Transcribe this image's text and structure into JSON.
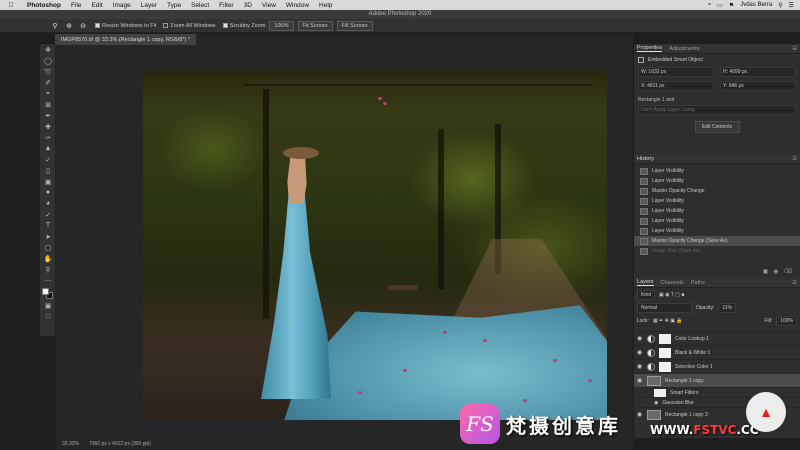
{
  "menubar": {
    "app": "Photoshop",
    "items": [
      "File",
      "Edit",
      "Image",
      "Layer",
      "Type",
      "Select",
      "Filter",
      "3D",
      "View",
      "Window",
      "Help"
    ],
    "user": "Jvdas Berra"
  },
  "app_title": "Adobe Photoshop 2020",
  "options": {
    "resize_windows": "Resize Windows to Fit",
    "zoom_all": "Zoom All Windows",
    "scrubby_zoom": "Scrubby Zoom",
    "zoom_pct": "100%",
    "fit_screen": "Fit Screen",
    "fill_screen": "Fill Screen"
  },
  "document_tab": "IMGP8570.tif @ 33.3% (Rectangle 1 copy, RGB/8*) *",
  "properties": {
    "tab_active": "Properties",
    "tab_other": "Adjustments",
    "object_type": "Embedded Smart Object",
    "w": "W: 1632 px",
    "h": "H: 4099 px",
    "x": "X: 4811 px",
    "y": "Y: 846 px",
    "comp_label": "Rectangle 1 and",
    "comp_placeholder": "Don't Apply Layer Comp",
    "edit_contents": "Edit Contents"
  },
  "history": {
    "title": "History",
    "items": [
      {
        "label": "Layer Visibility",
        "state": "normal"
      },
      {
        "label": "Layer Visibility",
        "state": "normal"
      },
      {
        "label": "Master Opacity Change",
        "state": "normal"
      },
      {
        "label": "Layer Visibility",
        "state": "normal"
      },
      {
        "label": "Layer Visibility",
        "state": "normal"
      },
      {
        "label": "Layer Visibility",
        "state": "normal"
      },
      {
        "label": "Layer Visibility",
        "state": "normal"
      },
      {
        "label": "Master Opacity Change (Save As)",
        "state": "selected"
      },
      {
        "label": "Image Size (Save As)",
        "state": "dim"
      }
    ]
  },
  "layers_panel": {
    "tabs": [
      "Layers",
      "Channels",
      "Paths"
    ],
    "kind": "Kind",
    "blend": "Normal",
    "opacity_label": "Opacity:",
    "opacity": "11%",
    "lock_label": "Lock:",
    "fill_label": "Fill:",
    "fill": "100%",
    "layers": [
      {
        "name": "Color Lookup 1",
        "type": "adjustment"
      },
      {
        "name": "Black & White 1",
        "type": "adjustment"
      },
      {
        "name": "Selective Color 1",
        "type": "adjustment"
      },
      {
        "name": "Rectangle 1 copy",
        "type": "smart",
        "selected": true
      },
      {
        "name": "Smart Filters",
        "type": "sub"
      },
      {
        "name": "Gaussian Blur",
        "type": "subsub"
      },
      {
        "name": "Rectangle 1 copy 3",
        "type": "smart"
      }
    ]
  },
  "status": {
    "zoom": "33.33%",
    "doc": "7360 px x 4912 px (300 ppi)"
  },
  "watermark": {
    "logo": "FS",
    "cn_text": "梵摄创意库",
    "url_prefix": "WWW.",
    "url_brand": "FSTVC",
    "url_suffix": ".CC"
  }
}
